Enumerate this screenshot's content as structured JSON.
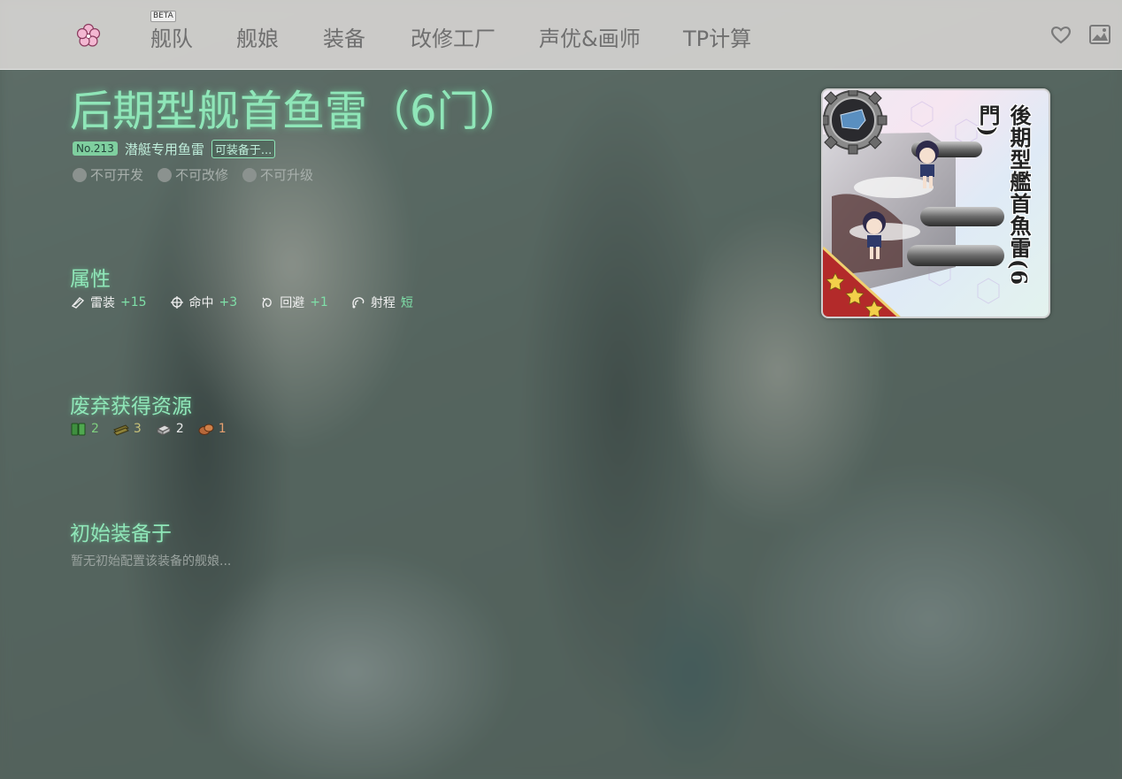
{
  "nav": {
    "items": [
      "舰队",
      "舰娘",
      "装备",
      "改修工厂",
      "声优&画师",
      "TP计算"
    ],
    "beta_badge": "BETA"
  },
  "equipment": {
    "name": "后期型舰首鱼雷（6门）",
    "number": "No.213",
    "type": "潜艇专用鱼雷",
    "equippable_label": "可装备于...",
    "flags": [
      "不可开发",
      "不可改修",
      "不可升级"
    ],
    "card_name": "後期型艦首魚雷(6門)"
  },
  "sections": {
    "stats_title": "属性",
    "scrap_title": "废弃获得资源",
    "initial_title": "初始装备于",
    "initial_empty": "暂无初始配置该装备的舰娘..."
  },
  "stats": [
    {
      "icon": "torpedo-icon",
      "label": "雷装",
      "value": "+15"
    },
    {
      "icon": "accuracy-icon",
      "label": "命中",
      "value": "+3"
    },
    {
      "icon": "evasion-icon",
      "label": "回避",
      "value": "+1"
    },
    {
      "icon": "range-icon",
      "label": "射程",
      "value": "短"
    }
  ],
  "scrap": [
    {
      "icon": "fuel-icon",
      "value": "2"
    },
    {
      "icon": "ammo-icon",
      "value": "3"
    },
    {
      "icon": "steel-icon",
      "value": "2"
    },
    {
      "icon": "bauxite-icon",
      "value": "1"
    }
  ],
  "colors": {
    "accent": "#8fe6b8",
    "topbar": "#ebe6e4"
  }
}
